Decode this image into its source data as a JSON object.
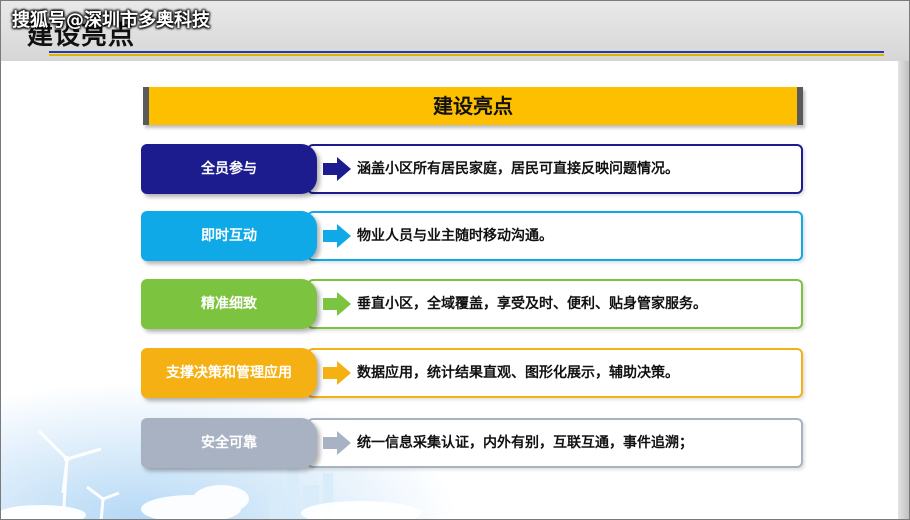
{
  "header": {
    "title": "建设亮点",
    "watermark": "搜狐号@深圳市多奥科技"
  },
  "banner": {
    "title": "建设亮点"
  },
  "colors": {
    "banner": "#fdbf00",
    "row1": "#1c1c8f",
    "row2": "#10a9e8",
    "row3": "#7cc33f",
    "row4": "#f5b113",
    "row5": "#a9b2c3"
  },
  "items": [
    {
      "label": "全员参与",
      "text": "涵盖小区所有居民家庭，居民可直接反映问题情况。",
      "color": "#1c1c8f",
      "border": "#1c1c8f",
      "arrow_icon": "right-arrow-icon"
    },
    {
      "label": "即时互动",
      "text": "物业人员与业主随时移动沟通。",
      "color": "#10a9e8",
      "border": "#10a9e8",
      "arrow_icon": "right-arrow-icon"
    },
    {
      "label": "精准细致",
      "text": "垂直小区，全域覆盖，享受及时、便利、贴身管家服务。",
      "color": "#7cc33f",
      "border": "#7cc33f",
      "arrow_icon": "right-arrow-icon"
    },
    {
      "label": "支撑决策和管理应用",
      "text": "数据应用，统计结果直观、图形化展示，辅助决策。",
      "color": "#f5b113",
      "border": "#f5b113",
      "arrow_icon": "right-arrow-icon"
    },
    {
      "label": "安全可靠",
      "text": "统一信息采集认证，内外有别，互联互通，事件追溯；",
      "color": "#a9b2c3",
      "border": "#a9b2c3",
      "arrow_icon": "right-arrow-icon"
    }
  ]
}
